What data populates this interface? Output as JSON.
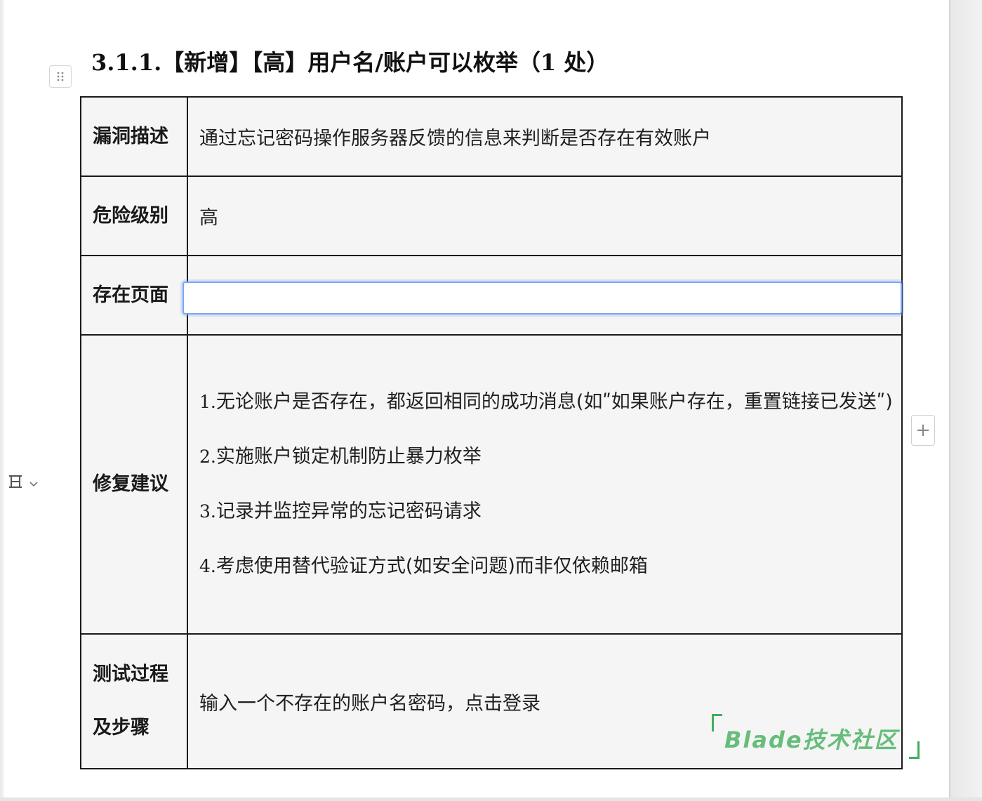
{
  "heading": "3.1.1.【新增】【高】用户名/账户可以枚举（1 处）",
  "table": {
    "description": {
      "label": "漏洞描述",
      "value": "通过忘记密码操作服务器反馈的信息来判断是否存在有效账户"
    },
    "risk_level": {
      "label": "危险级别",
      "value": "高"
    },
    "affected_page": {
      "label": "存在页面",
      "value": ""
    },
    "fix_suggestion": {
      "label": "修复建议",
      "items": [
        {
          "num": "1.",
          "text": "无论账户是否存在，都返回相同的成功消息(如ʺ如果账户存在，重置链接已发送ʺ)"
        },
        {
          "num": "2.",
          "text": "实施账户锁定机制防止暴力枚举"
        },
        {
          "num": "3.",
          "text": "记录并监控异常的忘记密码请求"
        },
        {
          "num": "4.",
          "text": "考虑使用替代验证方式(如安全问题)而非仅依赖邮箱"
        }
      ]
    },
    "test_process": {
      "label_line1": "测试过程",
      "label_line2": "及步骤",
      "value": "输入一个不存在的账户名密码，点击登录"
    }
  },
  "controls": {
    "add_symbol": "+"
  },
  "watermark": "Blade技术社区",
  "colors": {
    "cell_background": "#f5f5f5",
    "border": "#1a1a1a",
    "focus_outline": "#7aa6f3",
    "watermark_green": "#57b86f"
  },
  "icons": {
    "block_handle": "drag-handle-icon",
    "row_menu": "table-row-icon",
    "dropdown": "chevron-down-icon",
    "add": "plus-icon"
  }
}
